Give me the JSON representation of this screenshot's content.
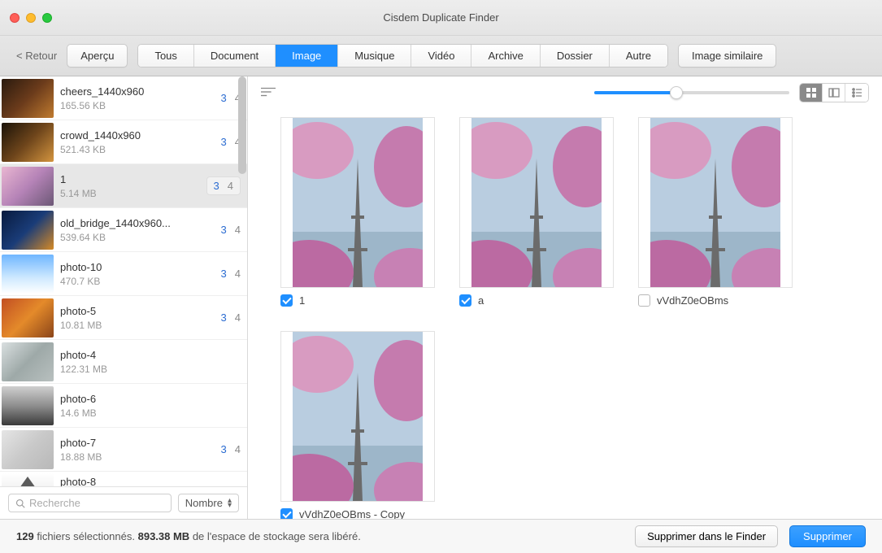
{
  "window": {
    "title": "Cisdem Duplicate Finder"
  },
  "toolbar": {
    "back": "< Retour",
    "preview": "Aperçu",
    "tabs": [
      "Tous",
      "Document",
      "Image",
      "Musique",
      "Vidéo",
      "Archive",
      "Dossier",
      "Autre"
    ],
    "active_tab": "Image",
    "similar": "Image similaire"
  },
  "sidebar": {
    "items": [
      {
        "name": "cheers_1440x960",
        "size": "165.56 KB",
        "sel": 3,
        "tot": 4,
        "thumb": "g1"
      },
      {
        "name": "crowd_1440x960",
        "size": "521.43 KB",
        "sel": 3,
        "tot": 4,
        "thumb": "g2"
      },
      {
        "name": "1",
        "size": "5.14 MB",
        "sel": 3,
        "tot": 4,
        "thumb": "g3",
        "selected": true
      },
      {
        "name": "old_bridge_1440x960...",
        "size": "539.64 KB",
        "sel": 3,
        "tot": 4,
        "thumb": "g4"
      },
      {
        "name": "photo-10",
        "size": "470.7 KB",
        "sel": 3,
        "tot": 4,
        "thumb": "g5"
      },
      {
        "name": "photo-5",
        "size": "10.81 MB",
        "sel": 3,
        "tot": 4,
        "thumb": "g6"
      },
      {
        "name": "photo-4",
        "size": "122.31 MB",
        "sel": "",
        "tot": "",
        "thumb": "g7"
      },
      {
        "name": "photo-6",
        "size": "14.6 MB",
        "sel": "",
        "tot": "",
        "thumb": "g8"
      },
      {
        "name": "photo-7",
        "size": "18.88 MB",
        "sel": 3,
        "tot": 4,
        "thumb": "g9"
      },
      {
        "name": "photo-8",
        "size": "",
        "sel": "",
        "tot": "",
        "thumb": "g10"
      }
    ],
    "search_placeholder": "Recherche",
    "sort_label": "Nombre"
  },
  "grid": {
    "items": [
      {
        "label": "1",
        "checked": true
      },
      {
        "label": "a",
        "checked": true
      },
      {
        "label": "vVdhZ0eOBms",
        "checked": false
      },
      {
        "label": "vVdhZ0eOBms - Copy",
        "checked": true
      }
    ]
  },
  "footer": {
    "count": "129",
    "selected_text": " fichiers sélectionnés. ",
    "size": "893.38 MB",
    "size_text": " de l'espace de stockage sera libéré.",
    "delete_finder": "Supprimer dans le Finder",
    "delete": "Supprimer"
  }
}
